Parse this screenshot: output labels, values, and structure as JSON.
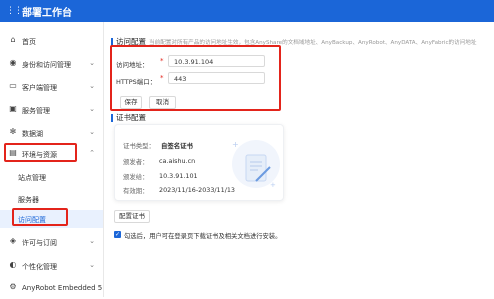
{
  "topbar": {
    "apps_icon": "grid-icon",
    "title": "部署工作台"
  },
  "sidebar": {
    "items": [
      {
        "label": "首页",
        "icon": "home-icon",
        "chevron": ""
      },
      {
        "label": "身份和访问管理",
        "icon": "user-icon",
        "chevron": "⌄"
      },
      {
        "label": "客户端管理",
        "icon": "monitor-icon",
        "chevron": "⌄"
      },
      {
        "label": "服务管理",
        "icon": "box-icon",
        "chevron": "⌄"
      },
      {
        "label": "数据湖",
        "icon": "gear-icon",
        "chevron": "⌄"
      },
      {
        "label": "环境与资源",
        "icon": "server-icon",
        "chevron": "⌃"
      },
      {
        "label": "许可与订阅",
        "icon": "license-icon",
        "chevron": "⌄"
      },
      {
        "label": "个性化管理",
        "icon": "palette-icon",
        "chevron": "⌄"
      },
      {
        "label": "AnyRobot Embedded 5",
        "icon": "robot-icon",
        "chevron": ""
      }
    ],
    "subitems": [
      {
        "label": "站点管理"
      },
      {
        "label": "服务器"
      },
      {
        "label": "访问配置"
      }
    ]
  },
  "access": {
    "title": "访问配置",
    "hint": "当前配置对所有产品的访问地址生效，包含AnyShare的文档域地址、AnyBackup、AnyRobot、AnyDATA、AnyFabric的访问地址",
    "address_label": "访问地址：",
    "address_value": "10.3.91.104",
    "port_label": "HTTPS端口：",
    "port_value": "443",
    "required_mark": "*",
    "help_mark": "?",
    "save_label": "保存",
    "cancel_label": "取消"
  },
  "cert": {
    "title": "证书配置",
    "type_label": "证书类型：",
    "type_value": "自签名证书",
    "issued_to_label": "颁发者：",
    "issued_to_value": "ca.aishu.cn",
    "issued_by_label": "颁发给：",
    "issued_by_value": "10.3.91.101",
    "validity_label": "有效期：",
    "validity_value": "2023/11/16-2033/11/13",
    "config_button": "配置证书",
    "checkbox_label": "勾选后，用户可在登录页下载证书及相关文档进行安装。",
    "checkbox_checked": true
  }
}
